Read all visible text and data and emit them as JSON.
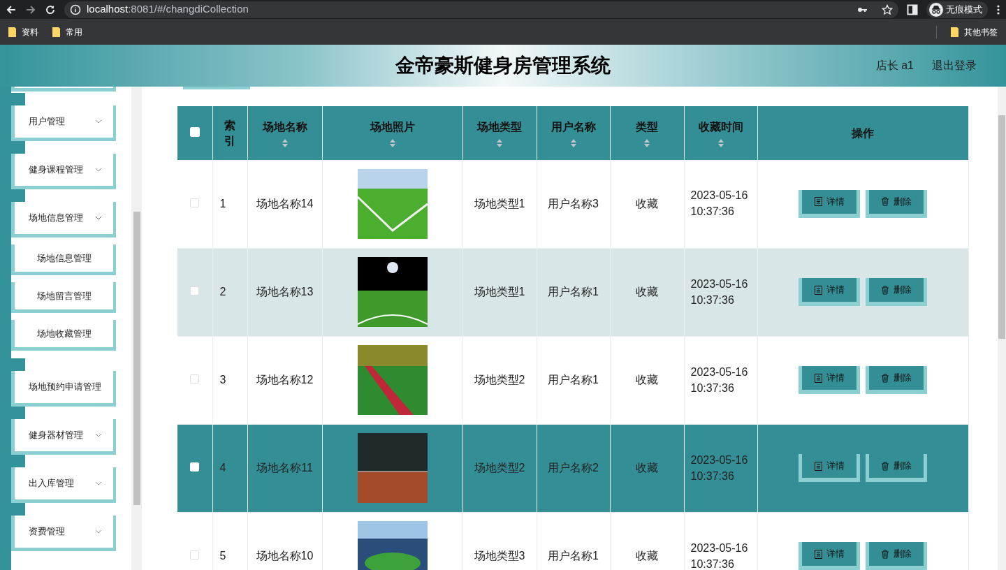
{
  "browser": {
    "url": {
      "host": "localhost",
      "path": ":8081/#/changdiCollection"
    },
    "profile": "无痕模式",
    "bookmarks": [
      "资料",
      "常用"
    ],
    "other_bookmarks": "其他书签"
  },
  "header": {
    "title": "金帝豪斯健身房管理系统",
    "user": "店长 a1",
    "logout": "退出登录"
  },
  "sidebar": {
    "items": [
      {
        "kind": "menu",
        "label": "用户管理",
        "expanded": false
      },
      {
        "kind": "menu",
        "label": "健身课程管理",
        "expanded": false
      },
      {
        "kind": "menu",
        "label": "场地信息管理",
        "expanded": true,
        "children": [
          {
            "label": "场地信息管理"
          },
          {
            "label": "场地留言管理"
          },
          {
            "label": "场地收藏管理"
          }
        ]
      },
      {
        "kind": "link",
        "label": "场地预约申请管理"
      },
      {
        "kind": "menu",
        "label": "健身器材管理",
        "expanded": false
      },
      {
        "kind": "menu",
        "label": "出入库管理",
        "expanded": false
      },
      {
        "kind": "menu",
        "label": "资费管理",
        "expanded": false
      }
    ]
  },
  "table": {
    "all_checked": false,
    "columns": [
      {
        "label": "索引",
        "sortable": false
      },
      {
        "label": "场地名称",
        "sortable": true
      },
      {
        "label": "场地照片",
        "sortable": true
      },
      {
        "label": "场地类型",
        "sortable": true
      },
      {
        "label": "用户名称",
        "sortable": true
      },
      {
        "label": "类型",
        "sortable": true
      },
      {
        "label": "收藏时间",
        "sortable": true
      },
      {
        "label": "操作",
        "sortable": false
      }
    ],
    "rows": [
      {
        "index": "1",
        "name": "场地名称14",
        "type": "场地类型1",
        "user": "用户名称3",
        "kind": "收藏",
        "time": "2023-05-16 10:37:36",
        "checked": false,
        "hovered": false,
        "actions": [
          {
            "kind": "detail",
            "label": "详情"
          },
          {
            "kind": "delete",
            "label": "删除"
          }
        ]
      },
      {
        "index": "2",
        "name": "场地名称13",
        "type": "场地类型1",
        "user": "用户名称1",
        "kind": "收藏",
        "time": "2023-05-16 10:37:36",
        "checked": false,
        "hovered": false,
        "actions": [
          {
            "kind": "detail",
            "label": "详情"
          },
          {
            "kind": "delete",
            "label": "删除"
          }
        ]
      },
      {
        "index": "3",
        "name": "场地名称12",
        "type": "场地类型2",
        "user": "用户名称1",
        "kind": "收藏",
        "time": "2023-05-16 10:37:36",
        "checked": false,
        "hovered": false,
        "actions": [
          {
            "kind": "detail",
            "label": "详情"
          },
          {
            "kind": "delete",
            "label": "删除"
          }
        ]
      },
      {
        "index": "4",
        "name": "场地名称11",
        "type": "场地类型2",
        "user": "用户名称2",
        "kind": "收藏",
        "time": "2023-05-16 10:37:36",
        "checked": false,
        "hovered": true,
        "actions": [
          {
            "kind": "detail",
            "label": "详情"
          },
          {
            "kind": "delete",
            "label": "删除"
          }
        ]
      },
      {
        "index": "5",
        "name": "场地名称10",
        "type": "场地类型3",
        "user": "用户名称1",
        "kind": "收藏",
        "time": "2023-05-16 10:37:36",
        "checked": false,
        "hovered": false,
        "actions": [
          {
            "kind": "detail",
            "label": "详情"
          },
          {
            "kind": "delete",
            "label": "删除"
          }
        ]
      }
    ]
  }
}
